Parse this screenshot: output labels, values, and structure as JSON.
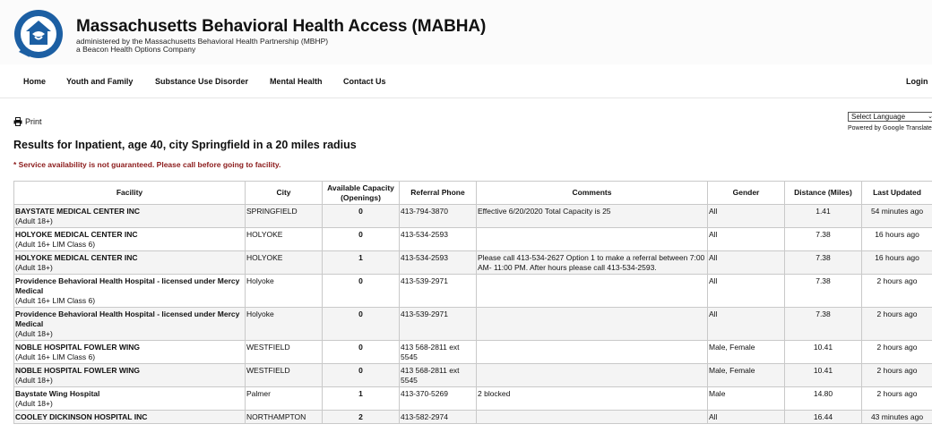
{
  "header": {
    "title": "Massachusetts Behavioral Health Access (MABHA)",
    "subtitle_line1": "administered by the Massachusetts Behavioral Health Partnership (MBHP)",
    "subtitle_line2": "a Beacon Health Options Company",
    "brand_color": "#1c5fa3"
  },
  "nav": {
    "home": "Home",
    "youth": "Youth and Family",
    "substance": "Substance Use Disorder",
    "mental": "Mental Health",
    "contact": "Contact Us",
    "login": "Login"
  },
  "print_label": "Print",
  "language": {
    "selected": "Select Language",
    "powered_prefix": "Powered by",
    "powered_brand": "Google",
    "powered_suffix": "Translate"
  },
  "results_heading": "Results for Inpatient, age 40, city Springfield in a 20 miles radius",
  "warning": "* Service availability is not guaranteed. Please call before going to facility.",
  "table": {
    "headers": {
      "facility": "Facility",
      "city": "City",
      "capacity_line1": "Available Capacity",
      "capacity_line2": "(Openings)",
      "phone": "Referral Phone",
      "comments": "Comments",
      "gender": "Gender",
      "distance": "Distance (Miles)",
      "updated": "Last Updated"
    },
    "rows": [
      {
        "name": "BAYSTATE MEDICAL CENTER INC",
        "sub": "(Adult 18+)",
        "city": "SPRINGFIELD",
        "capacity": "0",
        "phone": "413-794-3870",
        "comments": "Effective 6/20/2020 Total Capacity is 25",
        "gender": "All",
        "distance": "1.41",
        "updated": "54 minutes ago"
      },
      {
        "name": "HOLYOKE MEDICAL CENTER INC",
        "sub": "(Adult 16+ LIM Class 6)",
        "city": "HOLYOKE",
        "capacity": "0",
        "phone": "413-534-2593",
        "comments": "",
        "gender": "All",
        "distance": "7.38",
        "updated": "16 hours ago"
      },
      {
        "name": "HOLYOKE MEDICAL CENTER INC",
        "sub": "(Adult 18+)",
        "city": "HOLYOKE",
        "capacity": "1",
        "phone": "413-534-2593",
        "comments": "Please call 413-534-2627 Option 1 to make a referral between 7:00 AM- 11:00 PM. After hours please call 413-534-2593.",
        "gender": "All",
        "distance": "7.38",
        "updated": "16 hours ago"
      },
      {
        "name": "Providence Behavioral Health Hospital - licensed under Mercy Medical",
        "sub": "(Adult 16+ LIM Class 6)",
        "city": "Holyoke",
        "capacity": "0",
        "phone": "413-539-2971",
        "comments": "",
        "gender": "All",
        "distance": "7.38",
        "updated": "2 hours ago"
      },
      {
        "name": "Providence Behavioral Health Hospital - licensed under Mercy Medical",
        "sub": "(Adult 18+)",
        "city": "Holyoke",
        "capacity": "0",
        "phone": "413-539-2971",
        "comments": "",
        "gender": "All",
        "distance": "7.38",
        "updated": "2 hours ago"
      },
      {
        "name": "NOBLE HOSPITAL FOWLER WING",
        "sub": "(Adult 16+ LIM Class 6)",
        "city": "WESTFIELD",
        "capacity": "0",
        "phone": "413 568-2811 ext 5545",
        "comments": "",
        "gender": "Male, Female",
        "distance": "10.41",
        "updated": "2 hours ago"
      },
      {
        "name": "NOBLE HOSPITAL FOWLER WING",
        "sub": "(Adult 18+)",
        "city": "WESTFIELD",
        "capacity": "0",
        "phone": "413 568-2811 ext 5545",
        "comments": "",
        "gender": "Male, Female",
        "distance": "10.41",
        "updated": "2 hours ago"
      },
      {
        "name": "Baystate Wing Hospital",
        "sub": "(Adult 18+)",
        "city": "Palmer",
        "capacity": "1",
        "phone": "413-370-5269",
        "comments": "2 blocked",
        "gender": "Male",
        "distance": "14.80",
        "updated": "2 hours ago"
      },
      {
        "name": "COOLEY DICKINSON HOSPITAL INC",
        "sub": "",
        "city": "NORTHAMPTON",
        "capacity": "2",
        "phone": "413-582-2974",
        "comments": "",
        "gender": "All",
        "distance": "16.44",
        "updated": "43 minutes ago"
      }
    ]
  }
}
